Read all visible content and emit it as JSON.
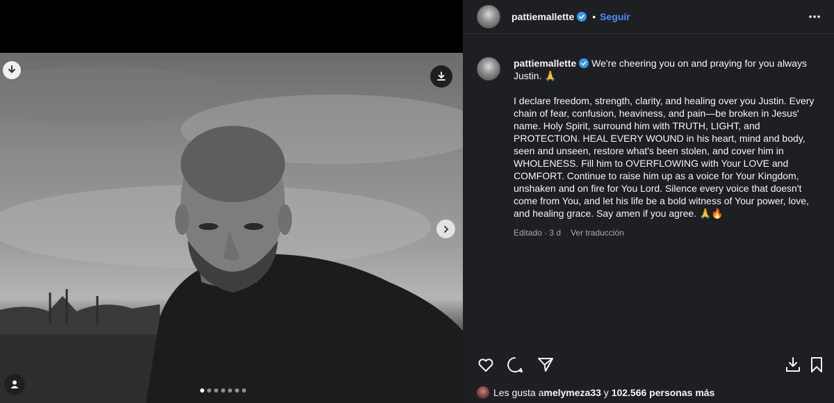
{
  "post": {
    "username": "pattiemallette",
    "follow_label": "Seguir",
    "bullet": "•",
    "caption_intro": "We're cheering you on and praying for you always Justin. 🙏",
    "caption_body": "I declare freedom, strength, clarity, and healing over you Justin. Every chain of fear, confusion, heaviness, and pain—be broken in Jesus' name. Holy Spirit, surround him with TRUTH, LIGHT, and PROTECTION. HEAL EVERY WOUND in his heart, mind and body, seen and unseen, restore what's been stolen, and cover him in WHOLENESS. Fill him to OVERFLOWING with Your LOVE and COMFORT. Continue to raise him up as a voice for Your Kingdom, unshaken and on fire for You Lord. Silence every voice that doesn't come from You, and let his life be a bold witness of Your power, love, and healing grace. Say amen if you agree. 🙏🔥",
    "edited_label": "Editado · 3 d",
    "translate_label": "Ver traducción"
  },
  "likes": {
    "prefix": "Les gusta a ",
    "user": "melymeza33",
    "connector": " y ",
    "count": "102.566 personas más"
  },
  "carousel": {
    "total_slides": 7,
    "active_index": 0
  },
  "icons": {
    "header": [
      "verified-badge-icon",
      "more-options-icon"
    ],
    "media": [
      "download-icon",
      "download-icon",
      "chevron-right-icon",
      "user-tag-icon"
    ],
    "actions": [
      "heart-icon",
      "comment-icon",
      "share-icon",
      "download-icon",
      "bookmark-icon"
    ]
  },
  "colors": {
    "panel_bg": "#1e1f22",
    "accent": "#4f8cff",
    "verified": "#3897f0",
    "secondary_text": "#a8a8a8"
  }
}
